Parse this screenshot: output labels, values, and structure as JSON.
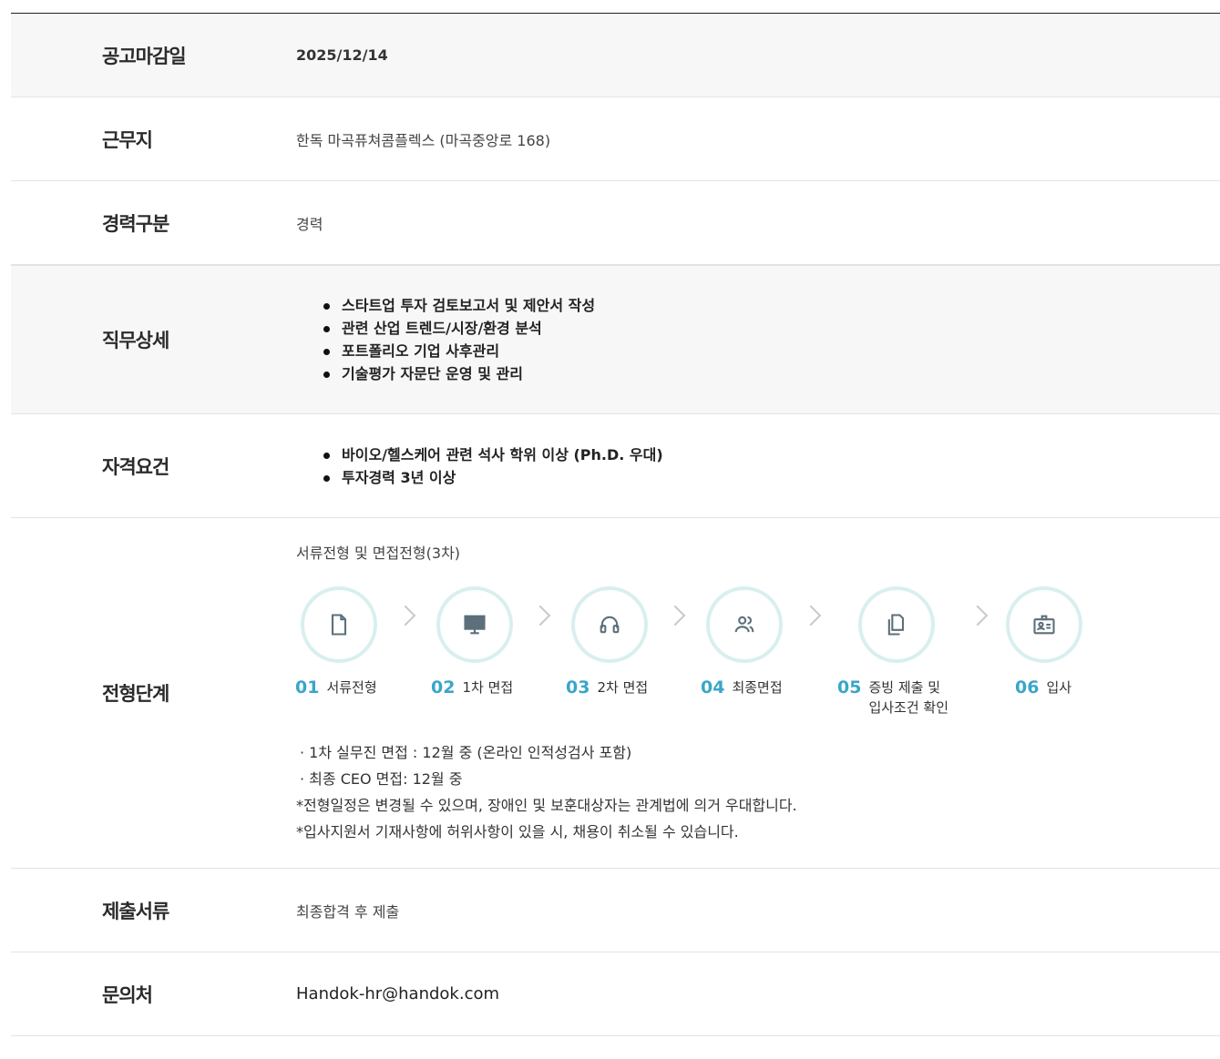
{
  "rows": {
    "deadline": {
      "label": "공고마감일",
      "value": "2025/12/14"
    },
    "location": {
      "label": "근무지",
      "value": "한독 마곡퓨쳐콤플렉스 (마곡중앙로 168)"
    },
    "career": {
      "label": "경력구분",
      "value": "경력"
    },
    "duties": {
      "label": "직무상세",
      "items": [
        "스타트업 투자 검토보고서 및 제안서 작성",
        "관련 산업 트렌드/시장/환경 분석",
        "포트폴리오 기업 사후관리",
        "기술평가 자문단 운영 및 관리"
      ]
    },
    "requirements": {
      "label": "자격요건",
      "items": [
        "바이오/헬스케어 관련 석사 학위 이상 (Ph.D. 우대)",
        "투자경력 3년 이상"
      ]
    },
    "process": {
      "label": "전형단계",
      "title": "서류전형 및 면접전형(3차)",
      "steps": [
        {
          "num": "01",
          "text": "서류전형",
          "icon": "document-icon"
        },
        {
          "num": "02",
          "text": "1차 면접",
          "icon": "monitor-icon"
        },
        {
          "num": "03",
          "text": "2차 면접",
          "icon": "headset-icon"
        },
        {
          "num": "04",
          "text": "최종면접",
          "icon": "users-icon"
        },
        {
          "num": "05",
          "text": "증빙 제출 및",
          "text2": "입사조건 확인",
          "icon": "copy-documents-icon"
        },
        {
          "num": "06",
          "text": "입사",
          "icon": "id-card-icon"
        }
      ],
      "notes": [
        "·  1차 실무진 면접 : 12월 중 (온라인 인적성검사 포함)",
        "·  최종 CEO 면접: 12월 중",
        "*전형일정은 변경될 수 있으며, 장애인 및 보훈대상자는 관계법에 의거 우대합니다.",
        "*입사지원서 기재사항에 허위사항이 있을 시, 채용이 취소될 수 있습니다."
      ]
    },
    "documents": {
      "label": "제출서류",
      "value": "최종합격 후 제출"
    },
    "contact": {
      "label": "문의처",
      "value": "Handok-hr@handok.com"
    }
  },
  "colors": {
    "accent": "#3aa6c8",
    "circle_border": "#d9efef",
    "icon": "#5c6f7a"
  }
}
